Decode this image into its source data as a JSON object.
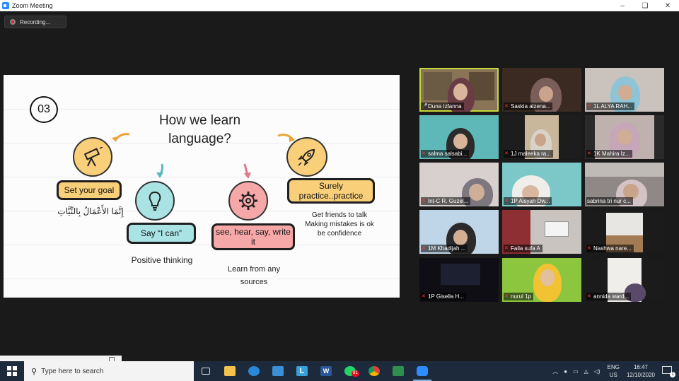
{
  "window": {
    "title": "Zoom Meeting",
    "controls": [
      "–",
      "❑",
      "✕"
    ]
  },
  "recording": {
    "label": "Recording..."
  },
  "slide": {
    "number": "03",
    "title_line1": "How we learn",
    "title_line2": "language?",
    "steps": [
      {
        "label": "Set your goal",
        "caption": "إِنَّمَا الأَعْمَالُ بِالنِّيَّاتِ",
        "color": "#f9cf7a",
        "icon": "telescope-icon"
      },
      {
        "label": "Say “I can”",
        "caption": "Positive thinking",
        "color": "#a9e3e3",
        "icon": "lightbulb-icon"
      },
      {
        "label": "see, hear, say, write it",
        "caption_line1": "Learn from any",
        "caption_line2": "sources",
        "color": "#f6a8a8",
        "icon": "gear-icon"
      },
      {
        "label_line1": "Surely",
        "label_line2": "practice..practice",
        "caption_line1": "Get friends to talk",
        "caption_line2": "Making mistakes is ok",
        "caption_line3": "be confidence",
        "color": "#f9cf7a",
        "icon": "rocket-icon"
      }
    ]
  },
  "gallery": [
    {
      "name": "Duna Izfanna",
      "muted": false,
      "active": true
    },
    {
      "name": "Saskia alzena...",
      "muted": true
    },
    {
      "name": "1L ALYA RAH...",
      "muted": true
    },
    {
      "name": "salma salsabi...",
      "muted": true
    },
    {
      "name": "1J maleeka ra...",
      "muted": true
    },
    {
      "name": "1K Mahira Iz...",
      "muted": true
    },
    {
      "name": "Int-C R. Guzel...",
      "muted": true
    },
    {
      "name": "1P Aisyah Dw...",
      "muted": true
    },
    {
      "name": "sabrina tri nur c...",
      "muted": false
    },
    {
      "name": "1M Khadijah ...",
      "muted": true
    },
    {
      "name": "Faila sufa A",
      "muted": true
    },
    {
      "name": "Nashwa nare...",
      "muted": true
    },
    {
      "name": "1P Gisella H...",
      "muted": true
    },
    {
      "name": "nurul 1p",
      "muted": true
    },
    {
      "name": "annida ward...",
      "muted": true
    }
  ],
  "taskbar": {
    "search_placeholder": "Type here to search",
    "apps": [
      "task-view-icon",
      "file-explorer-icon",
      "edge-icon",
      "mail-icon",
      "launcher-l-icon",
      "word-icon",
      "whatsapp-icon",
      "chrome-icon",
      "spreadsheet-icon",
      "zoom-icon"
    ],
    "whatsapp_badge": "81",
    "lang_line1": "ENG",
    "lang_line2": "US",
    "time": "16:47",
    "date": "12/10/2020",
    "notifications": "1"
  }
}
